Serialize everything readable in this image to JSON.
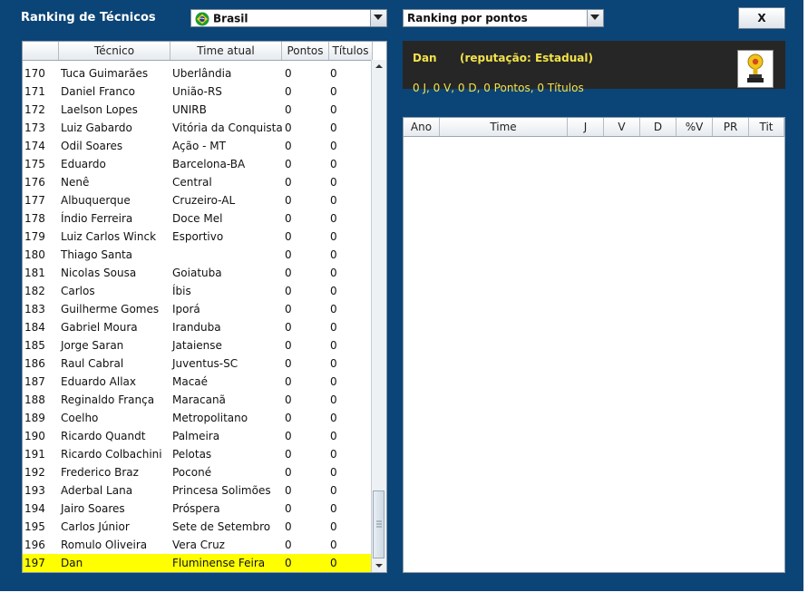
{
  "header": {
    "title": "Ranking de Técnicos",
    "country_select": "Brasil",
    "ranking_select": "Ranking por pontos",
    "close_label": "X"
  },
  "ranking_table": {
    "columns": [
      "Técnico",
      "Time atual",
      "Pontos",
      "Títulos"
    ],
    "rows": [
      {
        "pos": "170",
        "coach": "Tuca Guimarães",
        "team": "Uberlândia",
        "points": "0",
        "titles": "0"
      },
      {
        "pos": "171",
        "coach": "Daniel Franco",
        "team": "União-RS",
        "points": "0",
        "titles": "0"
      },
      {
        "pos": "172",
        "coach": "Laelson Lopes",
        "team": "UNIRB",
        "points": "0",
        "titles": "0"
      },
      {
        "pos": "173",
        "coach": "Luiz Gabardo",
        "team": "Vitória da Conquista",
        "points": "0",
        "titles": "0"
      },
      {
        "pos": "174",
        "coach": "Odil Soares",
        "team": "Ação - MT",
        "points": "0",
        "titles": "0"
      },
      {
        "pos": "175",
        "coach": "Eduardo",
        "team": "Barcelona-BA",
        "points": "0",
        "titles": "0"
      },
      {
        "pos": "176",
        "coach": "Nenê",
        "team": "Central",
        "points": "0",
        "titles": "0"
      },
      {
        "pos": "177",
        "coach": "Albuquerque",
        "team": "Cruzeiro-AL",
        "points": "0",
        "titles": "0"
      },
      {
        "pos": "178",
        "coach": "Índio Ferreira",
        "team": "Doce Mel",
        "points": "0",
        "titles": "0"
      },
      {
        "pos": "179",
        "coach": "Luiz Carlos Winck",
        "team": "Esportivo",
        "points": "0",
        "titles": "0"
      },
      {
        "pos": "180",
        "coach": "Thiago Santa",
        "team": "",
        "points": "0",
        "titles": "0"
      },
      {
        "pos": "181",
        "coach": "Nicolas Sousa",
        "team": "Goiatuba",
        "points": "0",
        "titles": "0"
      },
      {
        "pos": "182",
        "coach": "Carlos",
        "team": "Íbis",
        "points": "0",
        "titles": "0"
      },
      {
        "pos": "183",
        "coach": "Guilherme Gomes",
        "team": "Iporá",
        "points": "0",
        "titles": "0"
      },
      {
        "pos": "184",
        "coach": "Gabriel Moura",
        "team": "Iranduba",
        "points": "0",
        "titles": "0"
      },
      {
        "pos": "185",
        "coach": "Jorge Saran",
        "team": "Jataiense",
        "points": "0",
        "titles": "0"
      },
      {
        "pos": "186",
        "coach": "Raul Cabral",
        "team": "Juventus-SC",
        "points": "0",
        "titles": "0"
      },
      {
        "pos": "187",
        "coach": "Eduardo Allax",
        "team": "Macaé",
        "points": "0",
        "titles": "0"
      },
      {
        "pos": "188",
        "coach": "Reginaldo França",
        "team": "Maracanã",
        "points": "0",
        "titles": "0"
      },
      {
        "pos": "189",
        "coach": "Coelho",
        "team": "Metropolitano",
        "points": "0",
        "titles": "0"
      },
      {
        "pos": "190",
        "coach": "Ricardo Quandt",
        "team": "Palmeira",
        "points": "0",
        "titles": "0"
      },
      {
        "pos": "191",
        "coach": "Ricardo Colbachini",
        "team": "Pelotas",
        "points": "0",
        "titles": "0"
      },
      {
        "pos": "192",
        "coach": "Frederico Braz",
        "team": "Poconé",
        "points": "0",
        "titles": "0"
      },
      {
        "pos": "193",
        "coach": "Aderbal Lana",
        "team": "Princesa Solimões",
        "points": "0",
        "titles": "0"
      },
      {
        "pos": "194",
        "coach": "Jairo Soares",
        "team": "Próspera",
        "points": "0",
        "titles": "0"
      },
      {
        "pos": "195",
        "coach": "Carlos Júnior",
        "team": "Sete de Setembro",
        "points": "0",
        "titles": "0"
      },
      {
        "pos": "196",
        "coach": "Romulo Oliveira",
        "team": "Vera Cruz",
        "points": "0",
        "titles": "0"
      },
      {
        "pos": "197",
        "coach": "Dan",
        "team": "Fluminense Feira",
        "points": "0",
        "titles": "0",
        "selected": true
      }
    ]
  },
  "coach_info": {
    "name": "Dan",
    "reputation": "(reputação: Estadual)",
    "stats": "0 J, 0 V, 0 D, 0 Pontos, 0 Títulos"
  },
  "history_table": {
    "columns": [
      "Ano",
      "Time",
      "J",
      "V",
      "D",
      "%V",
      "PR",
      "Tit"
    ]
  },
  "colors": {
    "background": "#0b4476",
    "selected_row": "#ffff00",
    "info_text": "#f3e34a",
    "info_panel": "#262626"
  },
  "icons": [
    "brazil-flag-icon",
    "dropdown-arrow-icon",
    "trophy-icon",
    "scroll-up-icon",
    "scroll-down-icon"
  ]
}
